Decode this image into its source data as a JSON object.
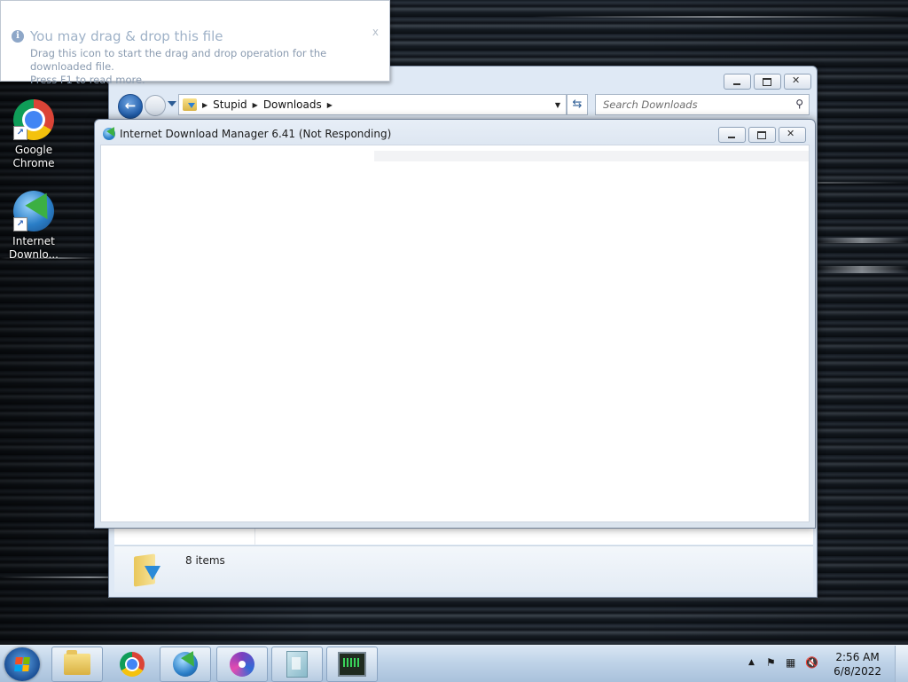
{
  "desktop": {
    "icons": [
      {
        "label": "Google\nChrome",
        "icon": "chrome-icon"
      },
      {
        "label": "Internet\nDownlo...",
        "icon": "idm-icon"
      }
    ]
  },
  "balloon": {
    "title": "You may drag & drop this file",
    "line1": "Drag this icon to start the drag and drop operation for the downloaded file.",
    "line2": "Press F1 to read more.",
    "close": "x"
  },
  "explorer": {
    "breadcrumb": [
      "Stupid",
      "Downloads"
    ],
    "search_placeholder": "Search Downloads",
    "status_count": "8 items"
  },
  "idm_window": {
    "title": "Internet Download Manager 6.41 (Not Responding)"
  },
  "taskbar": {
    "clock_time": "2:56 AM",
    "clock_date": "6/8/2022",
    "pinned": [
      "folder-icon",
      "chrome-icon",
      "idm-icon",
      "disc-burner-icon",
      "document-icon",
      "monitor-icon"
    ]
  }
}
